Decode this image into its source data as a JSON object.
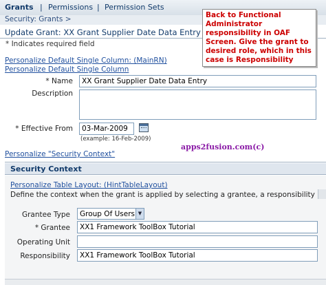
{
  "tabs": [
    {
      "label": "Grants"
    },
    {
      "label": "Permissions"
    },
    {
      "label": "Permission Sets"
    }
  ],
  "breadcrumb": "Security: Grants  >",
  "page_title": "Update Grant: XX Grant Supplier Date Data Entry",
  "required_note": "* Indicates required field",
  "personalize_links": {
    "main_rn": "Personalize Default Single Column: (MainRN)",
    "default": "Personalize Default Single Column",
    "security_context": "Personalize \"Security Context\""
  },
  "callout_text": "Back to Functional Administrator responsibility in OAF Screen. Give the grant to desired role, which in this case is Responsibility",
  "watermark": "apps2fusion.com(c)",
  "form": {
    "name_label": "* Name",
    "name_value": "XX Grant Supplier Date Data Entry",
    "description_label": "Description",
    "description_value": "",
    "effective_from_label": "* Effective From",
    "effective_from_value": "03-Mar-2009",
    "date_example": "(example: 16-Feb-2009)"
  },
  "security_context": {
    "heading": "Security Context",
    "personalize_link": "Personalize Table Layout: (HintTableLayout)",
    "description": "Define the context when the grant is applied by selecting a grantee, a responsibility and/or ope",
    "grantee_type_label": "Grantee Type",
    "grantee_type_value": "Group Of Users",
    "grantee_label": "* Grantee",
    "grantee_value": "XX1 Framework ToolBox Tutorial",
    "operating_unit_label": "Operating Unit",
    "operating_unit_value": "",
    "responsibility_label": "Responsibility",
    "responsibility_value": "XX1 Framework ToolBox Tutorial"
  },
  "icons": {
    "calendar": "calendar-icon",
    "dropdown": "chevron-down-icon"
  }
}
